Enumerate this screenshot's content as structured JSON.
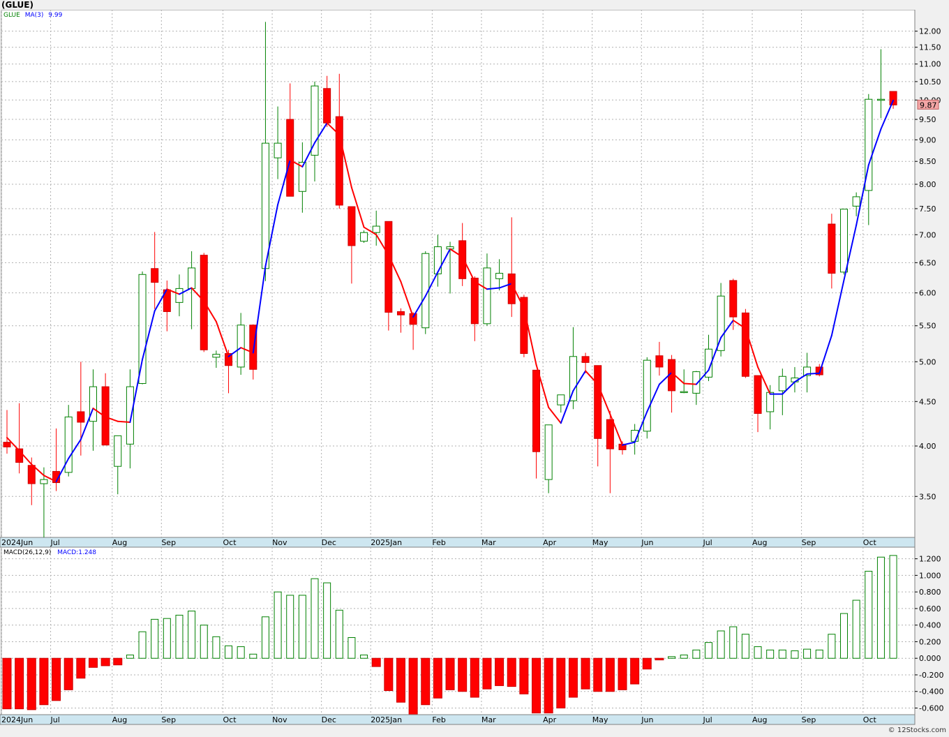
{
  "window": {
    "title": "(GLUE)",
    "watermark": "© 12Stocks.com"
  },
  "price_legend": {
    "symbol": "GLUE",
    "ma_label": "MA(3)",
    "ma_value": "9.99"
  },
  "macd_legend": {
    "params": "MACD(26,12,9)",
    "value_label": "MACD:1.248"
  },
  "last_price_label": "9.87",
  "colors": {
    "up": "#008000",
    "down": "#ff0000",
    "ma_up": "#0000ff",
    "ma_down": "#ff0000",
    "last_bg": "#f4a6a6"
  },
  "chart_data": [
    {
      "type": "candlestick",
      "title": "(GLUE)",
      "scale": "log",
      "ylim": [
        3.14,
        12.7
      ],
      "y_ticks": [
        "12.00",
        "11.50",
        "11.00",
        "10.50",
        "10.00",
        "9.50",
        "9.00",
        "8.50",
        "8.00",
        "7.50",
        "7.00",
        "6.50",
        "6.00",
        "5.50",
        "5.00",
        "4.50",
        "4.00",
        "3.50"
      ],
      "x_labels": [
        {
          "label": "2024Jun",
          "week": 0
        },
        {
          "label": "Jul",
          "week": 4
        },
        {
          "label": "Aug",
          "week": 9
        },
        {
          "label": "Sep",
          "week": 13
        },
        {
          "label": "Oct",
          "week": 18
        },
        {
          "label": "Nov",
          "week": 22
        },
        {
          "label": "Dec",
          "week": 26
        },
        {
          "label": "2025Jan",
          "week": 30
        },
        {
          "label": "Feb",
          "week": 35
        },
        {
          "label": "Mar",
          "week": 39
        },
        {
          "label": "Apr",
          "week": 44
        },
        {
          "label": "May",
          "week": 48
        },
        {
          "label": "Jun",
          "week": 52
        },
        {
          "label": "Jul",
          "week": 57
        },
        {
          "label": "Aug",
          "week": 61
        },
        {
          "label": "Sep",
          "week": 65
        },
        {
          "label": "Oct",
          "week": 70
        }
      ],
      "grid": true,
      "candles": [
        {
          "o": 4.04,
          "h": 4.4,
          "l": 3.92,
          "c": 3.99
        },
        {
          "o": 3.97,
          "h": 4.48,
          "l": 3.72,
          "c": 3.83
        },
        {
          "o": 3.8,
          "h": 3.88,
          "l": 3.42,
          "c": 3.62
        },
        {
          "o": 3.62,
          "h": 3.78,
          "l": 3.14,
          "c": 3.66
        },
        {
          "o": 3.74,
          "h": 4.19,
          "l": 3.55,
          "c": 3.63
        },
        {
          "o": 3.73,
          "h": 4.46,
          "l": 3.69,
          "c": 4.32
        },
        {
          "o": 4.38,
          "h": 5.0,
          "l": 3.9,
          "c": 4.26
        },
        {
          "o": 4.27,
          "h": 4.9,
          "l": 3.95,
          "c": 4.68
        },
        {
          "o": 4.68,
          "h": 4.85,
          "l": 4.02,
          "c": 4.01
        },
        {
          "o": 3.79,
          "h": 4.02,
          "l": 3.52,
          "c": 4.11
        },
        {
          "o": 4.02,
          "h": 4.9,
          "l": 3.77,
          "c": 4.68
        },
        {
          "o": 4.72,
          "h": 6.35,
          "l": 4.71,
          "c": 6.3
        },
        {
          "o": 6.4,
          "h": 7.05,
          "l": 5.75,
          "c": 6.17
        },
        {
          "o": 6.05,
          "h": 6.2,
          "l": 5.42,
          "c": 5.71
        },
        {
          "o": 5.85,
          "h": 6.3,
          "l": 5.64,
          "c": 6.07
        },
        {
          "o": 6.07,
          "h": 6.7,
          "l": 5.45,
          "c": 6.41
        },
        {
          "o": 6.63,
          "h": 6.67,
          "l": 5.13,
          "c": 5.16
        },
        {
          "o": 5.06,
          "h": 5.15,
          "l": 4.92,
          "c": 5.1
        },
        {
          "o": 5.11,
          "h": 5.16,
          "l": 4.6,
          "c": 4.95
        },
        {
          "o": 4.93,
          "h": 5.69,
          "l": 4.83,
          "c": 5.51
        },
        {
          "o": 5.51,
          "h": 5.52,
          "l": 4.77,
          "c": 4.9
        },
        {
          "o": 6.4,
          "h": 12.3,
          "l": 6.19,
          "c": 8.92
        },
        {
          "o": 8.58,
          "h": 9.83,
          "l": 8.11,
          "c": 8.92
        },
        {
          "o": 9.5,
          "h": 10.45,
          "l": 7.75,
          "c": 7.75
        },
        {
          "o": 7.85,
          "h": 8.94,
          "l": 7.42,
          "c": 8.48
        },
        {
          "o": 8.64,
          "h": 10.5,
          "l": 8.06,
          "c": 10.38
        },
        {
          "o": 10.31,
          "h": 10.66,
          "l": 9.31,
          "c": 9.41
        },
        {
          "o": 9.57,
          "h": 10.72,
          "l": 7.5,
          "c": 7.57
        },
        {
          "o": 7.54,
          "h": 7.54,
          "l": 6.15,
          "c": 6.8
        },
        {
          "o": 6.88,
          "h": 7.08,
          "l": 6.85,
          "c": 7.04
        },
        {
          "o": 7.04,
          "h": 7.46,
          "l": 6.8,
          "c": 7.16
        },
        {
          "o": 7.25,
          "h": 7.25,
          "l": 5.43,
          "c": 5.7
        },
        {
          "o": 5.71,
          "h": 5.76,
          "l": 5.4,
          "c": 5.66
        },
        {
          "o": 5.68,
          "h": 5.7,
          "l": 5.16,
          "c": 5.52
        },
        {
          "o": 5.47,
          "h": 6.7,
          "l": 5.38,
          "c": 6.66
        },
        {
          "o": 6.31,
          "h": 7.0,
          "l": 6.1,
          "c": 6.78
        },
        {
          "o": 6.74,
          "h": 6.87,
          "l": 5.99,
          "c": 6.78
        },
        {
          "o": 6.89,
          "h": 7.22,
          "l": 6.11,
          "c": 6.23
        },
        {
          "o": 6.24,
          "h": 6.27,
          "l": 5.28,
          "c": 5.53
        },
        {
          "o": 5.53,
          "h": 6.66,
          "l": 5.5,
          "c": 6.41
        },
        {
          "o": 6.23,
          "h": 6.56,
          "l": 6.04,
          "c": 6.32
        },
        {
          "o": 6.31,
          "h": 7.33,
          "l": 5.63,
          "c": 5.83
        },
        {
          "o": 5.93,
          "h": 5.97,
          "l": 5.06,
          "c": 5.11
        },
        {
          "o": 4.89,
          "h": 4.88,
          "l": 3.67,
          "c": 3.94
        },
        {
          "o": 3.66,
          "h": 4.23,
          "l": 3.53,
          "c": 4.23
        },
        {
          "o": 4.46,
          "h": 4.58,
          "l": 4.37,
          "c": 4.58
        },
        {
          "o": 4.51,
          "h": 5.48,
          "l": 4.41,
          "c": 5.07
        },
        {
          "o": 5.07,
          "h": 5.12,
          "l": 4.85,
          "c": 4.99
        },
        {
          "o": 4.95,
          "h": 4.94,
          "l": 3.79,
          "c": 4.08
        },
        {
          "o": 4.29,
          "h": 4.39,
          "l": 3.53,
          "c": 3.97
        },
        {
          "o": 4.02,
          "h": 4.05,
          "l": 3.91,
          "c": 3.96
        },
        {
          "o": 4.05,
          "h": 4.24,
          "l": 3.91,
          "c": 4.17
        },
        {
          "o": 4.16,
          "h": 5.06,
          "l": 4.08,
          "c": 5.02
        },
        {
          "o": 5.08,
          "h": 5.27,
          "l": 4.82,
          "c": 4.93
        },
        {
          "o": 5.03,
          "h": 5.09,
          "l": 4.37,
          "c": 4.63
        },
        {
          "o": 4.61,
          "h": 4.9,
          "l": 4.6,
          "c": 4.62
        },
        {
          "o": 4.6,
          "h": 4.88,
          "l": 4.46,
          "c": 4.87
        },
        {
          "o": 4.8,
          "h": 5.37,
          "l": 4.75,
          "c": 5.17
        },
        {
          "o": 5.15,
          "h": 6.16,
          "l": 5.07,
          "c": 5.95
        },
        {
          "o": 6.2,
          "h": 6.23,
          "l": 5.44,
          "c": 5.63
        },
        {
          "o": 5.69,
          "h": 5.75,
          "l": 4.79,
          "c": 4.81
        },
        {
          "o": 4.82,
          "h": 4.82,
          "l": 4.15,
          "c": 4.36
        },
        {
          "o": 4.38,
          "h": 4.7,
          "l": 4.18,
          "c": 4.61
        },
        {
          "o": 4.63,
          "h": 4.91,
          "l": 4.34,
          "c": 4.81
        },
        {
          "o": 4.74,
          "h": 4.93,
          "l": 4.61,
          "c": 4.79
        },
        {
          "o": 4.82,
          "h": 5.12,
          "l": 4.61,
          "c": 4.93
        },
        {
          "o": 4.93,
          "h": 4.97,
          "l": 4.81,
          "c": 4.83
        },
        {
          "o": 7.2,
          "h": 7.4,
          "l": 6.07,
          "c": 6.32
        },
        {
          "o": 6.34,
          "h": 7.49,
          "l": 6.3,
          "c": 7.49
        },
        {
          "o": 7.55,
          "h": 7.83,
          "l": 7.35,
          "c": 7.74
        },
        {
          "o": 7.87,
          "h": 10.16,
          "l": 7.18,
          "c": 10.02
        },
        {
          "o": 10.0,
          "h": 11.44,
          "l": 9.53,
          "c": 10.02
        },
        {
          "o": 10.23,
          "h": 10.2,
          "l": 9.77,
          "c": 9.87
        }
      ],
      "ma": {
        "name": "MA(3)",
        "values": [
          4.09,
          3.95,
          3.81,
          3.7,
          3.64,
          3.87,
          4.07,
          4.42,
          4.32,
          4.27,
          4.26,
          5.03,
          5.72,
          6.06,
          5.98,
          6.08,
          5.87,
          5.56,
          5.07,
          5.19,
          5.12,
          6.44,
          7.58,
          8.53,
          8.38,
          8.93,
          9.41,
          9.12,
          7.93,
          7.14,
          7.0,
          6.63,
          6.18,
          5.63,
          5.95,
          6.34,
          6.74,
          6.6,
          6.18,
          6.06,
          6.08,
          6.15,
          5.76,
          4.96,
          4.43,
          4.25,
          4.63,
          4.88,
          4.71,
          4.35,
          4.01,
          4.04,
          4.38,
          4.71,
          4.86,
          4.72,
          4.71,
          4.89,
          5.33,
          5.58,
          5.46,
          4.93,
          4.59,
          4.59,
          4.74,
          4.84,
          4.85,
          5.36,
          6.21,
          7.18,
          8.42,
          9.26,
          9.99
        ]
      }
    },
    {
      "type": "bar",
      "title": "MACD(26,12,9)",
      "ylim": [
        -0.68,
        1.34
      ],
      "y_ticks": [
        "1.200",
        "1.000",
        "0.800",
        "0.600",
        "0.400",
        "0.200",
        "0.000",
        "-0.200",
        "-0.400",
        "-0.600"
      ],
      "values": [
        -0.61,
        -0.61,
        -0.62,
        -0.56,
        -0.51,
        -0.38,
        -0.24,
        -0.11,
        -0.09,
        -0.08,
        0.04,
        0.32,
        0.47,
        0.48,
        0.52,
        0.57,
        0.4,
        0.26,
        0.15,
        0.14,
        0.05,
        0.5,
        0.8,
        0.76,
        0.76,
        0.96,
        0.91,
        0.58,
        0.25,
        0.04,
        -0.1,
        -0.39,
        -0.53,
        -0.68,
        -0.56,
        -0.48,
        -0.38,
        -0.4,
        -0.47,
        -0.37,
        -0.33,
        -0.34,
        -0.43,
        -0.66,
        -0.66,
        -0.6,
        -0.47,
        -0.37,
        -0.4,
        -0.4,
        -0.38,
        -0.31,
        -0.13,
        -0.02,
        0.02,
        0.04,
        0.1,
        0.19,
        0.33,
        0.38,
        0.29,
        0.14,
        0.1,
        0.1,
        0.09,
        0.11,
        0.1,
        0.29,
        0.54,
        0.7,
        1.05,
        1.22,
        1.24
      ]
    }
  ]
}
